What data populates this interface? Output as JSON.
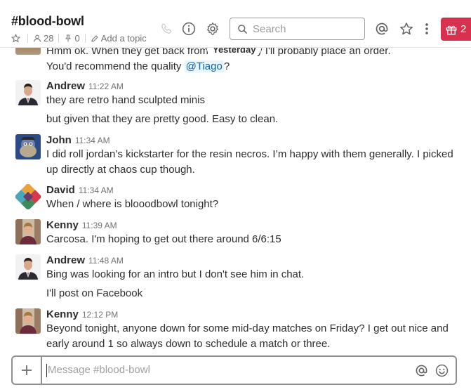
{
  "header": {
    "channel": "#blood-bowl",
    "members_count": "28",
    "pinned_count": "0",
    "add_topic": "Add a topic",
    "search_placeholder": "Search",
    "gift_count": "2"
  },
  "day_divider": "Yesterday",
  "messages": [
    {
      "author": "",
      "time": "",
      "lines": [
        "Hmm ok. When they get back from the holiday I'll probably place an order."
      ],
      "mention_line": {
        "before": "You'd recommend the quality ",
        "mention": "@Tiago",
        "after": "?"
      }
    },
    {
      "author": "Andrew",
      "time": "11:22 AM",
      "lines": [
        "they are retro hand sculpted minis",
        "but given that they are pretty good. Easy to clean."
      ]
    },
    {
      "author": "John",
      "time": "11:34 AM",
      "lines": [
        "I did roll jordan’s kickstarter for the resin necros. I’m happy with them generally. I picked",
        "up directly at chaos cup though."
      ]
    },
    {
      "author": "David",
      "time": "11:34 AM",
      "lines": [
        "When / where is blooodbowl tonight?"
      ]
    },
    {
      "author": "Kenny",
      "time": "11:39 AM",
      "lines": [
        "Carcosa. I'm hoping to get out there around 6/6:15"
      ]
    },
    {
      "author": "Andrew",
      "time": "11:48 AM",
      "lines": [
        "Bing was looking for an intro but I don't see him in chat.",
        "I'll post on Facebook"
      ]
    },
    {
      "author": "Kenny",
      "time": "12:12 PM",
      "lines": [
        "Beyond tonight, anyone down for some mid-day matches on Friday? I get out nice and",
        "early around 1 so always down to schedule a match or three."
      ]
    }
  ],
  "composer": {
    "placeholder": "Message #blood-bowl"
  },
  "colors": {
    "mention": "#1264a3",
    "gift_badge": "#d8314f",
    "text": "#2c2d30",
    "muted": "#717274"
  }
}
